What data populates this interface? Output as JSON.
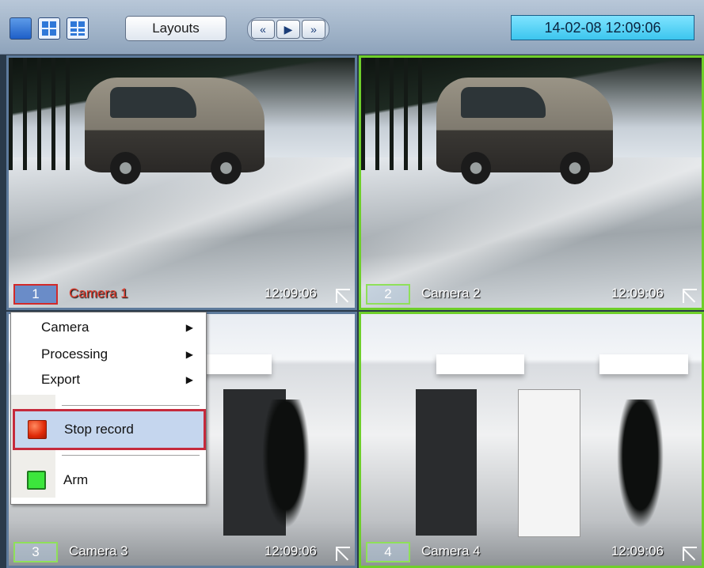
{
  "toolbar": {
    "layouts_label": "Layouts",
    "nav": {
      "rewind": "«",
      "play": "▶",
      "forward": "»"
    },
    "datetime": "14-02-08   12:09:06"
  },
  "cameras": [
    {
      "number": "1",
      "name": "Camera 1",
      "time": "12:09:06",
      "selected": true
    },
    {
      "number": "2",
      "name": "Camera 2",
      "time": "12:09:06",
      "selected": false
    },
    {
      "number": "3",
      "name": "Camera 3",
      "time": "12:09:06",
      "selected": false
    },
    {
      "number": "4",
      "name": "Camera 4",
      "time": "12:09:06",
      "selected": false
    }
  ],
  "context_menu": {
    "items": [
      {
        "label": "Camera",
        "submenu": true
      },
      {
        "label": "Processing",
        "submenu": true
      },
      {
        "label": "Export",
        "submenu": true
      }
    ],
    "stop_record": {
      "label": "Stop record",
      "icon": "stop-record-icon"
    },
    "arm": {
      "label": "Arm",
      "icon": "arm-icon"
    }
  },
  "colors": {
    "selected_outline": "#c52a3c",
    "active_frame": "#6fcf2a",
    "clock_bg": "#3cc6ee"
  }
}
